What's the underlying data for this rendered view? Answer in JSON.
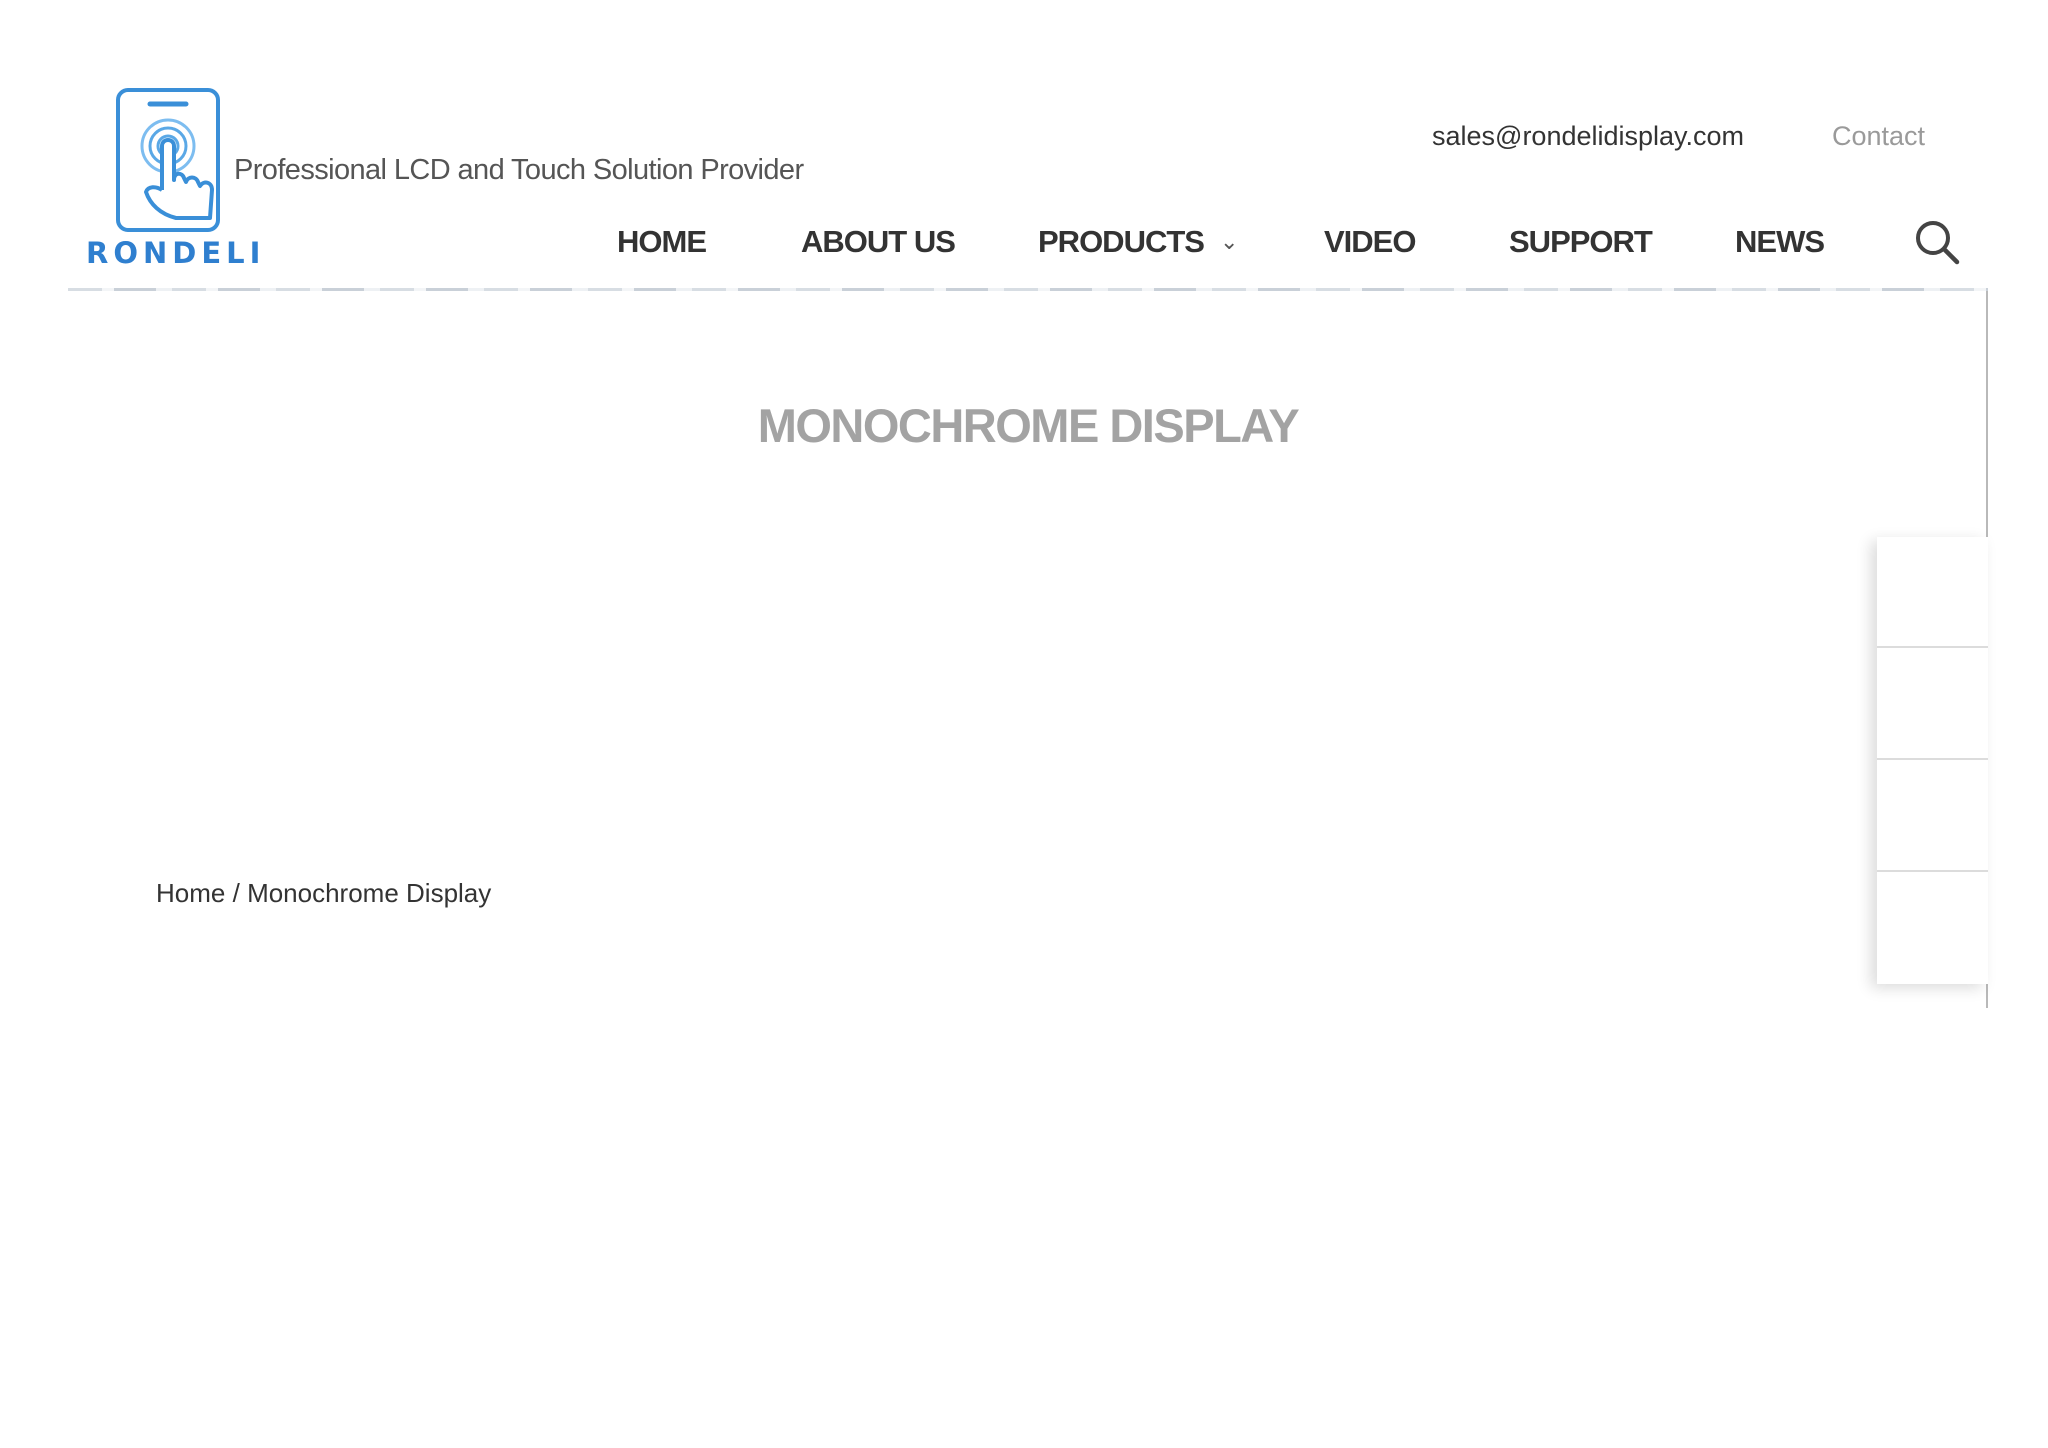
{
  "header": {
    "brand": "RONDELI",
    "tagline": "Professional LCD and Touch Solution Provider",
    "email": "sales@rondelidisplay.com",
    "contact_label": "Contact",
    "brand_color": "#2f7fcf"
  },
  "nav": {
    "items": [
      {
        "label": "HOME"
      },
      {
        "label": "ABOUT US"
      },
      {
        "label": "PRODUCTS",
        "has_dropdown": true
      },
      {
        "label": "VIDEO"
      },
      {
        "label": "SUPPORT"
      },
      {
        "label": "NEWS"
      }
    ],
    "search_icon": "search-icon"
  },
  "banner": {
    "title": "MONOCHROME DISPLAY"
  },
  "breadcrumb": {
    "home": "Home",
    "separator": "/",
    "current": "Monochrome Display"
  },
  "side_panel": {
    "buttons": 4
  }
}
